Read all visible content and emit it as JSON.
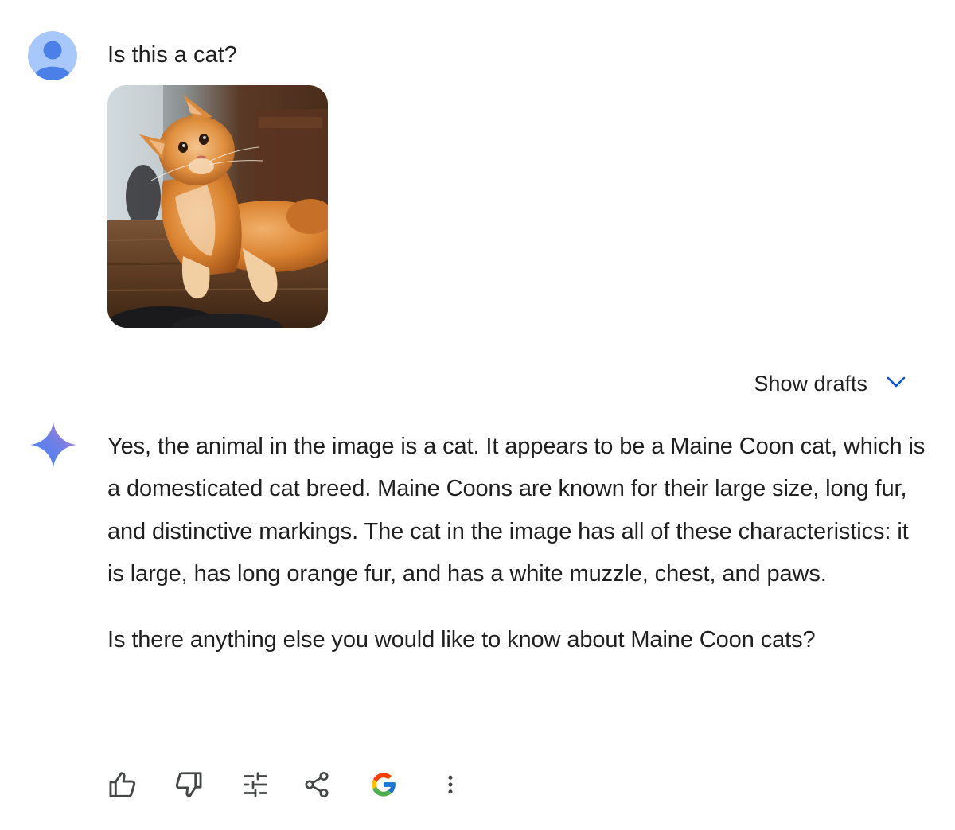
{
  "user_turn": {
    "prompt": "Is this a cat?",
    "image_subject": "orange long-haired cat lying on a wooden table looking up"
  },
  "drafts": {
    "label": "Show drafts",
    "icon": "chevron-down-icon"
  },
  "model_turn": {
    "icon": "gemini-sparkle-icon",
    "paragraphs": [
      "Yes, the animal in the image is a cat. It appears to be a Maine Coon cat, which is a domesticated cat breed. Maine Coons are known for their large size, long fur, and distinctive markings. The cat in the image has all of these characteristics: it is large, has long orange fur, and has a white muzzle, chest, and paws.",
      "Is there anything else you would like to know about Maine Coon cats?"
    ]
  },
  "actions": [
    {
      "icon": "thumbs-up-icon"
    },
    {
      "icon": "thumbs-down-icon"
    },
    {
      "icon": "modify-response-icon"
    },
    {
      "icon": "share-icon"
    },
    {
      "icon": "google-icon"
    },
    {
      "icon": "more-options-icon"
    }
  ],
  "colors": {
    "text": "#1f1f1f",
    "accent_blue": "#0b57d0",
    "icon_gray": "#444746",
    "avatar_bg": "#a8c7fa",
    "avatar_fg": "#4a80e8"
  }
}
